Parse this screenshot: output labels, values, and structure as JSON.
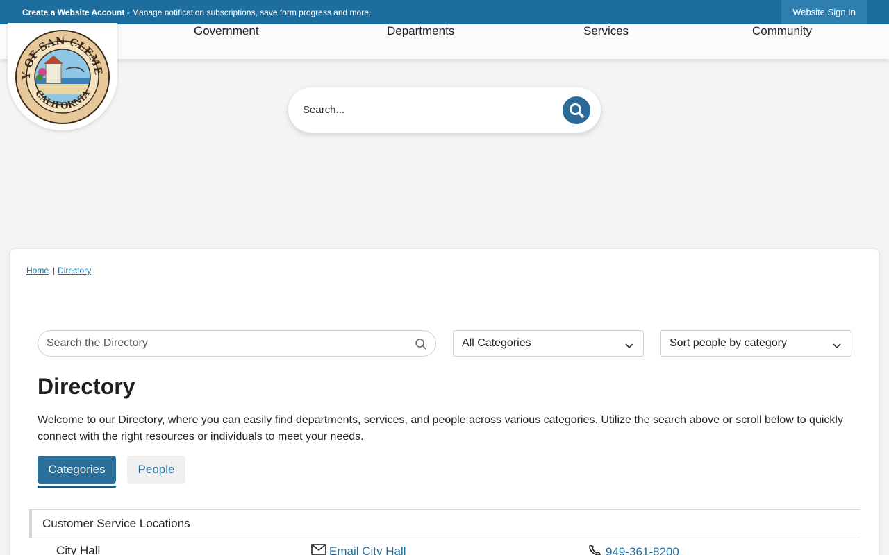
{
  "topbar": {
    "account_link": "Create a Website Account",
    "account_desc": " - Manage notification subscriptions, save form progress and more.",
    "signin": "Website Sign In",
    "bg_color": "#1d6e9e"
  },
  "logo": {
    "alt": "City of San Clemente California seal",
    "text_top": "CITY OF SAN CLEMENTE",
    "text_bottom": "CALIFORNIA"
  },
  "nav": {
    "items": [
      "Government",
      "Departments",
      "Services",
      "Community"
    ]
  },
  "hero_search": {
    "placeholder": "Search...",
    "icon": "search-icon"
  },
  "breadcrumb": {
    "home": "Home",
    "separator": "|",
    "current": "Directory"
  },
  "directory_search": {
    "placeholder": "Search the Directory",
    "icon": "search-icon"
  },
  "filters": {
    "category_selected": "All Categories",
    "sort_selected": "Sort people by category"
  },
  "page": {
    "title": "Directory",
    "intro": "Welcome to our Directory, where you can easily find departments, services, and people across various categories. Utilize the search above or scroll below to quickly connect with the right resources or individuals to meet your needs."
  },
  "tabs": {
    "categories": "Categories",
    "people": "People",
    "active": "Categories"
  },
  "sections": [
    {
      "title": "Customer Service Locations",
      "rows": [
        {
          "name": "City Hall",
          "email_label": "Email City Hall",
          "phone": "949-361-8200"
        }
      ]
    }
  ],
  "colors": {
    "accent": "#1d6e9e",
    "tab_active": "#2b6f9b"
  }
}
